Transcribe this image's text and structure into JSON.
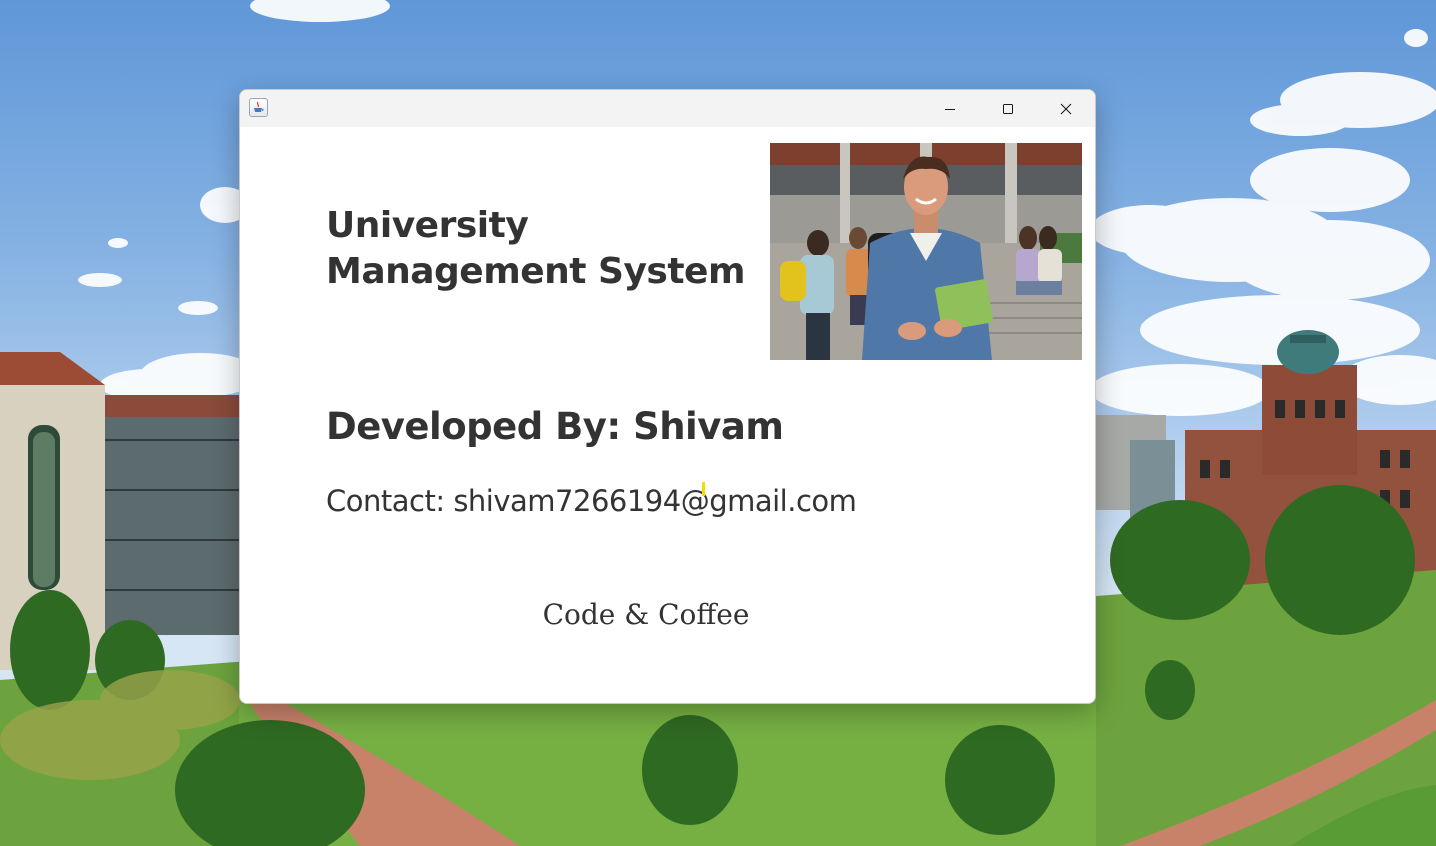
{
  "window": {
    "title": "",
    "controls": {
      "minimize_icon": "minimize-icon",
      "maximize_icon": "maximize-icon",
      "close_icon": "close-icon"
    }
  },
  "about": {
    "title_line1": "University",
    "title_line2": "Management System",
    "developed_by": "Developed By: Shivam",
    "contact": "Contact: shivam7266194@gmail.com",
    "footer": "Code & Coffee"
  },
  "colors": {
    "text": "#333333",
    "window_background": "#ffffff",
    "titlebar_background": "#f3f3f3",
    "caret": "#f0e000"
  },
  "icons": {
    "app": "java-cup-icon"
  }
}
